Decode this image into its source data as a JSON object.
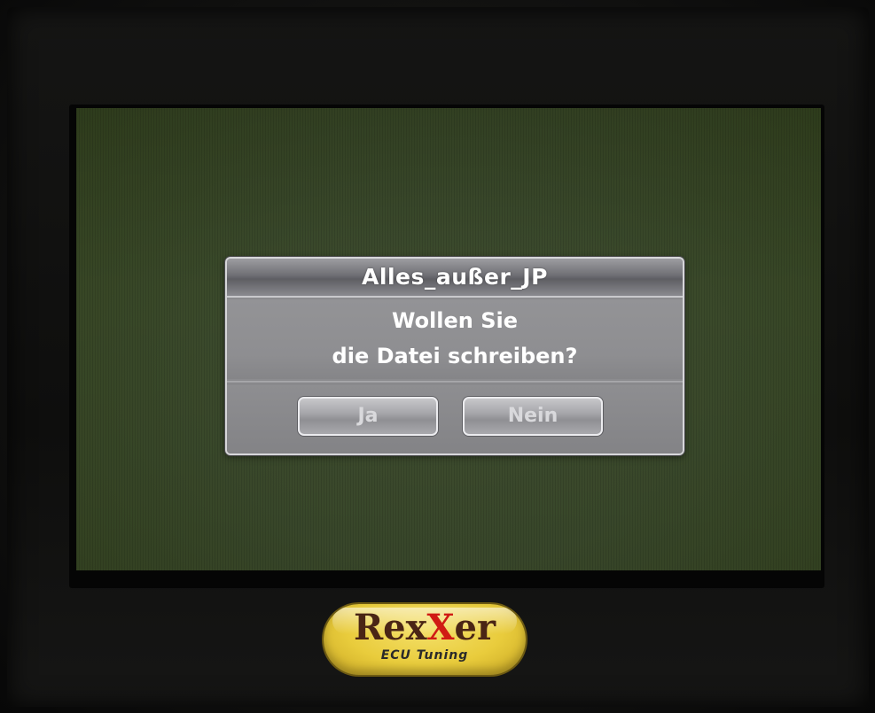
{
  "dialog": {
    "title": "Alles_außer_JP",
    "message_line1": "Wollen Sie",
    "message_line2": "die Datei schreiben?",
    "yes_label": "Ja",
    "no_label": "Nein"
  },
  "logo": {
    "rex": "Rex",
    "x": "X",
    "er": "er",
    "sub": "ECU Tuning"
  },
  "colors": {
    "screen_background": "#3b4a2c",
    "dialog_background": "#8c8c8f",
    "dialog_text": "#ffffff",
    "logo_gold": "#e9cc3c",
    "logo_red": "#d01b14"
  },
  "icons": {
    "logo": "rexxer-logo"
  }
}
